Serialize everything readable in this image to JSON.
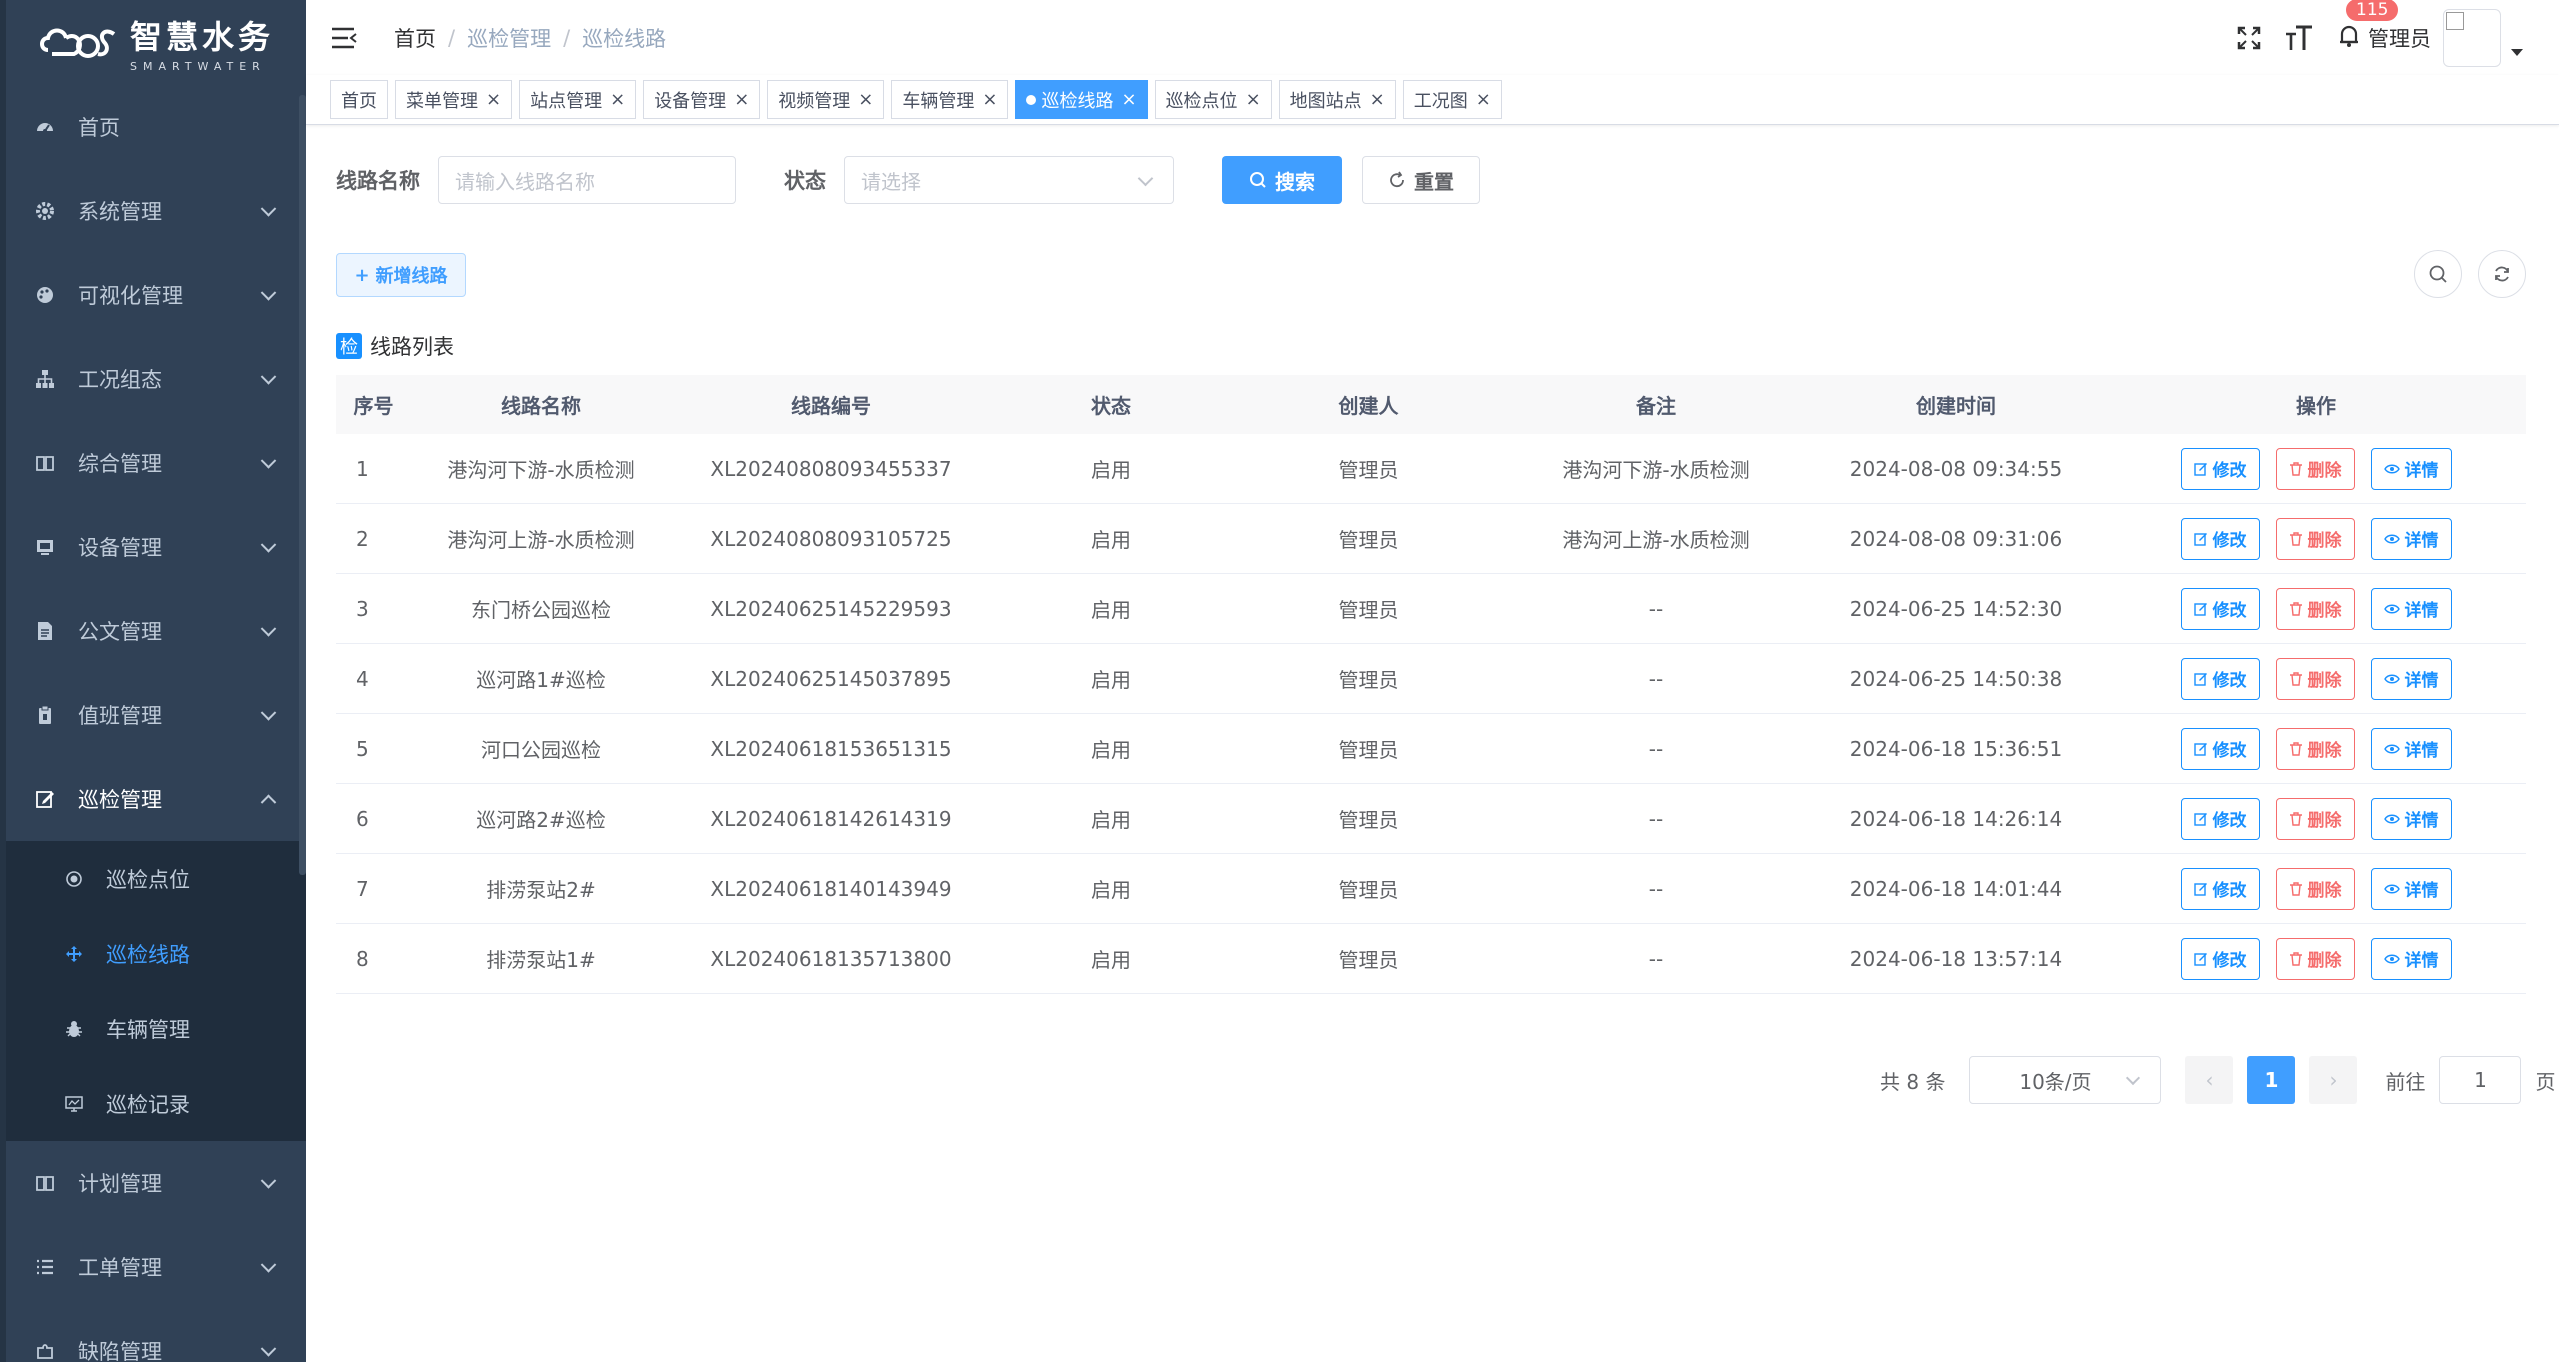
{
  "app": {
    "logo_title": "智慧水务",
    "logo_sub": "SMARTWATER"
  },
  "sidebar": {
    "items": [
      {
        "label": "首页",
        "icon": "dashboard-icon"
      },
      {
        "label": "系统管理",
        "icon": "gear-icon"
      },
      {
        "label": "可视化管理",
        "icon": "palette-icon"
      },
      {
        "label": "工况组态",
        "icon": "sitemap-icon"
      },
      {
        "label": "综合管理",
        "icon": "book-icon"
      },
      {
        "label": "设备管理",
        "icon": "monitor-icon"
      },
      {
        "label": "公文管理",
        "icon": "document-icon"
      },
      {
        "label": "值班管理",
        "icon": "clipboard-icon"
      },
      {
        "label": "巡检管理",
        "icon": "edit-icon"
      }
    ],
    "submenu": [
      {
        "label": "巡检点位",
        "icon": "radio-icon"
      },
      {
        "label": "巡检线路",
        "icon": "move-icon"
      },
      {
        "label": "车辆管理",
        "icon": "bug-icon"
      },
      {
        "label": "巡检记录",
        "icon": "screen-icon"
      }
    ],
    "items_after": [
      {
        "label": "计划管理",
        "icon": "book-icon"
      },
      {
        "label": "工单管理",
        "icon": "list-icon"
      },
      {
        "label": "缺陷管理",
        "icon": "puzzle-icon"
      }
    ]
  },
  "header": {
    "breadcrumb": [
      "首页",
      "巡检管理",
      "巡检线路"
    ],
    "badge_count": "115",
    "user": "管理员"
  },
  "tags": [
    {
      "label": "首页",
      "closable": false,
      "active": false
    },
    {
      "label": "菜单管理",
      "closable": true,
      "active": false
    },
    {
      "label": "站点管理",
      "closable": true,
      "active": false
    },
    {
      "label": "设备管理",
      "closable": true,
      "active": false
    },
    {
      "label": "视频管理",
      "closable": true,
      "active": false
    },
    {
      "label": "车辆管理",
      "closable": true,
      "active": false
    },
    {
      "label": "巡检线路",
      "closable": true,
      "active": true
    },
    {
      "label": "巡检点位",
      "closable": true,
      "active": false
    },
    {
      "label": "地图站点",
      "closable": true,
      "active": false
    },
    {
      "label": "工况图",
      "closable": true,
      "active": false
    }
  ],
  "filter": {
    "route_label": "线路名称",
    "route_placeholder": "请输入线路名称",
    "status_label": "状态",
    "status_placeholder": "请选择",
    "search_btn": "搜索",
    "reset_btn": "重置"
  },
  "toolbar": {
    "add_btn": "新增线路"
  },
  "list": {
    "title_chip": "检",
    "title": "线路列表",
    "columns": [
      "序号",
      "线路名称",
      "线路编号",
      "状态",
      "创建人",
      "备注",
      "创建时间",
      "操作"
    ],
    "actions": {
      "edit": "修改",
      "delete": "删除",
      "detail": "详情"
    },
    "rows": [
      {
        "no": "1",
        "name": "港沟河下游-水质检测",
        "code": "XL20240808093455337",
        "status": "启用",
        "creator": "管理员",
        "remark": "港沟河下游-水质检测",
        "time": "2024-08-08 09:34:55"
      },
      {
        "no": "2",
        "name": "港沟河上游-水质检测",
        "code": "XL20240808093105725",
        "status": "启用",
        "creator": "管理员",
        "remark": "港沟河上游-水质检测",
        "time": "2024-08-08 09:31:06"
      },
      {
        "no": "3",
        "name": "东门桥公园巡检",
        "code": "XL20240625145229593",
        "status": "启用",
        "creator": "管理员",
        "remark": "--",
        "time": "2024-06-25 14:52:30"
      },
      {
        "no": "4",
        "name": "巡河路1#巡检",
        "code": "XL20240625145037895",
        "status": "启用",
        "creator": "管理员",
        "remark": "--",
        "time": "2024-06-25 14:50:38"
      },
      {
        "no": "5",
        "name": "河口公园巡检",
        "code": "XL20240618153651315",
        "status": "启用",
        "creator": "管理员",
        "remark": "--",
        "time": "2024-06-18 15:36:51"
      },
      {
        "no": "6",
        "name": "巡河路2#巡检",
        "code": "XL20240618142614319",
        "status": "启用",
        "creator": "管理员",
        "remark": "--",
        "time": "2024-06-18 14:26:14"
      },
      {
        "no": "7",
        "name": "排涝泵站2#",
        "code": "XL20240618140143949",
        "status": "启用",
        "creator": "管理员",
        "remark": "--",
        "time": "2024-06-18 14:01:44"
      },
      {
        "no": "8",
        "name": "排涝泵站1#",
        "code": "XL20240618135713800",
        "status": "启用",
        "creator": "管理员",
        "remark": "--",
        "time": "2024-06-18 13:57:14"
      }
    ]
  },
  "pagination": {
    "total": "共 8 条",
    "page_size": "10条/页",
    "current": "1",
    "goto_label": "前往",
    "goto_value": "1",
    "page_unit": "页"
  },
  "colors": {
    "sidebar_bg": "#304156",
    "submenu_bg": "#1f2d3d",
    "primary": "#409eff",
    "danger": "#f56c6c"
  }
}
